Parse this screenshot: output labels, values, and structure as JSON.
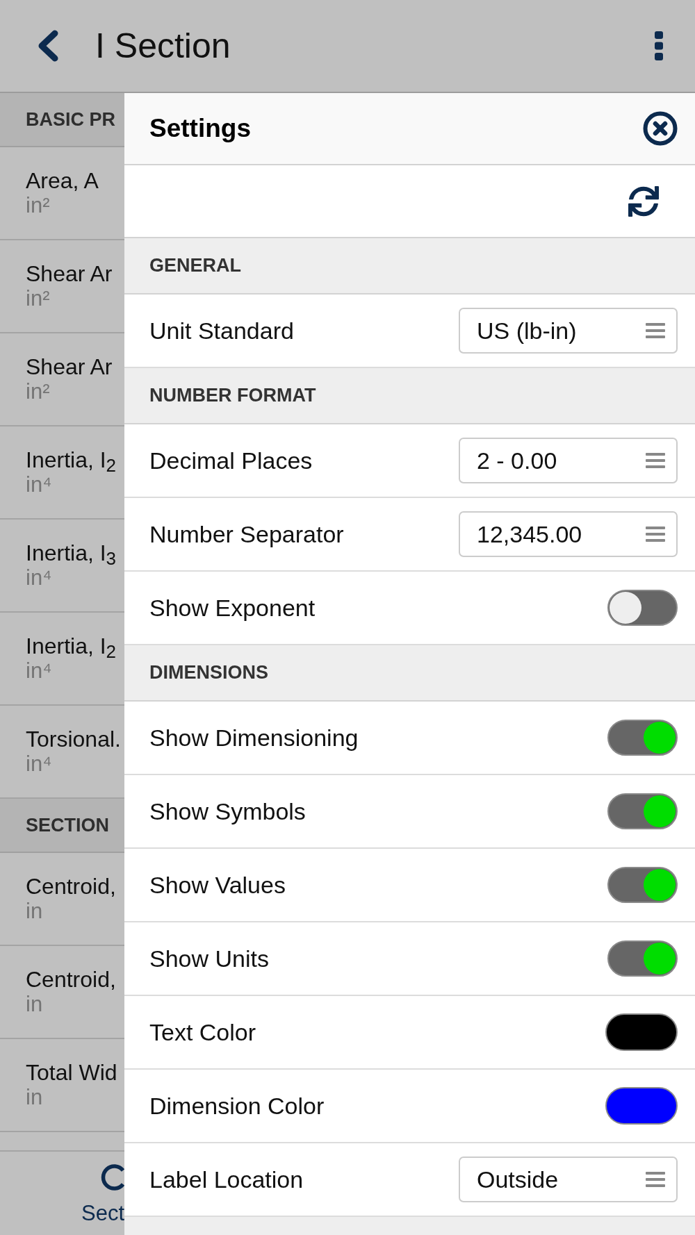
{
  "app_bar": {
    "title": "I Section"
  },
  "properties": {
    "sections": [
      {
        "title": "BASIC PR",
        "rows": [
          {
            "label": "Area, A",
            "unit": "in²"
          },
          {
            "label": "Shear Ar",
            "unit": "in²"
          },
          {
            "label": "Shear Ar",
            "unit": "in²"
          },
          {
            "label": "Inertia, I$_{2}$",
            "unit": "in⁴"
          },
          {
            "label": "Inertia, I$_{3}$",
            "unit": "in⁴"
          },
          {
            "label": "Inertia, I$_{2}$",
            "unit": "in⁴"
          },
          {
            "label": "Torsional.",
            "unit": "in⁴"
          }
        ]
      },
      {
        "title": "SECTION",
        "rows": [
          {
            "label": "Centroid,",
            "unit": "in"
          },
          {
            "label": "Centroid,",
            "unit": "in"
          },
          {
            "label": "Total Wid",
            "unit": "in"
          }
        ]
      }
    ]
  },
  "bottom_tab": {
    "label": "Sect"
  },
  "settings": {
    "title": "Settings",
    "sections": [
      {
        "title": "GENERAL",
        "rows": [
          {
            "kind": "select",
            "label": "Unit Standard",
            "value": "US (lb-in)"
          }
        ]
      },
      {
        "title": "NUMBER FORMAT",
        "rows": [
          {
            "kind": "select",
            "label": "Decimal Places",
            "value": "2 - 0.00"
          },
          {
            "kind": "select",
            "label": "Number Separator",
            "value": "12,345.00"
          },
          {
            "kind": "toggle",
            "label": "Show Exponent",
            "on": false
          }
        ]
      },
      {
        "title": "DIMENSIONS",
        "rows": [
          {
            "kind": "toggle",
            "label": "Show Dimensioning",
            "on": true
          },
          {
            "kind": "toggle",
            "label": "Show Symbols",
            "on": true
          },
          {
            "kind": "toggle",
            "label": "Show Values",
            "on": true
          },
          {
            "kind": "toggle",
            "label": "Show Units",
            "on": true
          },
          {
            "kind": "color",
            "label": "Text Color",
            "color": "#000000"
          },
          {
            "kind": "color",
            "label": "Dimension Color",
            "color": "#0000ff"
          },
          {
            "kind": "select",
            "label": "Label Location",
            "value": "Outside"
          }
        ]
      }
    ]
  }
}
